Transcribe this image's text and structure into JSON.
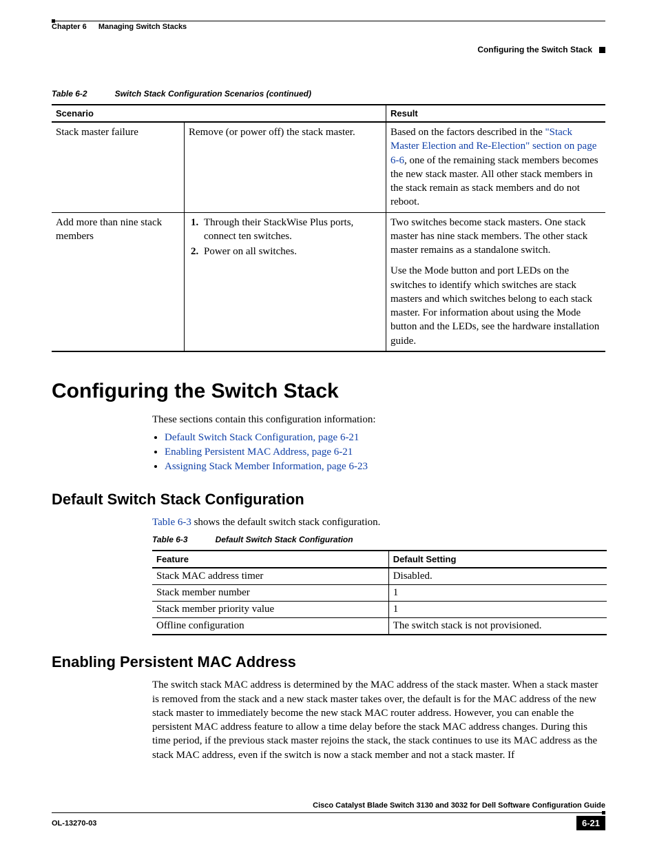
{
  "header": {
    "chapter_label": "Chapter 6",
    "chapter_title": "Managing Switch Stacks",
    "section_title": "Configuring the Switch Stack"
  },
  "table62": {
    "caption_num": "Table 6-2",
    "caption_title": "Switch Stack Configuration Scenarios (continued)",
    "head_scenario": "Scenario",
    "head_result": "Result",
    "row1": {
      "scenario": "Stack master failure",
      "action": "Remove (or power off) the stack master.",
      "result_pre": "Based on the factors described in the ",
      "result_link": "\"Stack Master Election and Re-Election\" section on page 6-6",
      "result_post": ", one of the remaining stack members becomes the new stack master. All other stack members in the stack remain as stack members and do not reboot."
    },
    "row2": {
      "scenario": "Add more than nine stack members",
      "step1": "Through their StackWise Plus ports, connect ten switches.",
      "step2": "Power on all switches.",
      "result_p1": "Two switches become stack masters. One stack master has nine stack members. The other stack master remains as a standalone switch.",
      "result_p2": "Use the Mode button and port LEDs on the switches to identify which switches are stack masters and which switches belong to each stack master. For information about using the Mode button and the LEDs, see the hardware installation guide."
    }
  },
  "h1": "Configuring the Switch Stack",
  "intro": "These sections contain this configuration information:",
  "links": {
    "l1": "Default Switch Stack Configuration, page 6-21",
    "l2": "Enabling Persistent MAC Address, page 6-21",
    "l3": "Assigning Stack Member Information, page 6-23"
  },
  "h2a": "Default Switch Stack Configuration",
  "t63_ref": "Table 6-3",
  "t63_intro_post": " shows the default switch stack configuration.",
  "table63": {
    "caption_num": "Table 6-3",
    "caption_title": "Default Switch Stack Configuration",
    "head_feature": "Feature",
    "head_default": "Default Setting",
    "rows": [
      {
        "f": "Stack MAC address timer",
        "d": "Disabled."
      },
      {
        "f": "Stack member number",
        "d": "1"
      },
      {
        "f": "Stack member priority value",
        "d": "1"
      },
      {
        "f": "Offline configuration",
        "d": "The switch stack is not provisioned."
      }
    ]
  },
  "h2b": "Enabling Persistent MAC Address",
  "persist_p": "The switch stack MAC address is determined by the MAC address of the stack master. When a stack master is removed from the stack and a new stack master takes over, the default is for the MAC address of the new stack master to immediately become the new stack MAC router address. However, you can enable the persistent MAC address feature to allow a time delay before the stack MAC address changes. During this time period, if the previous stack master rejoins the stack, the stack continues to use its MAC address as the stack MAC address, even if the switch is now a stack member and not a stack master. If",
  "footer": {
    "book": "Cisco Catalyst Blade Switch 3130 and 3032 for Dell Software Configuration Guide",
    "docnum": "OL-13270-03",
    "page": "6-21"
  }
}
